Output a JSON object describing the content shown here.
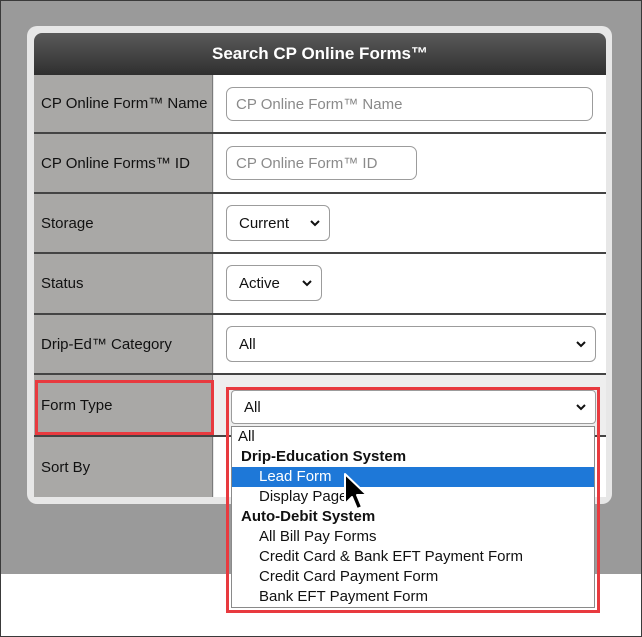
{
  "form": {
    "title": "Search CP Online Forms™",
    "fields": {
      "name": {
        "label": "CP Online Form™ Name",
        "placeholder": "CP Online Form™ Name"
      },
      "id": {
        "label": "CP Online Forms™ ID",
        "placeholder": "CP Online Form™ ID"
      },
      "storage": {
        "label": "Storage",
        "value": "Current"
      },
      "status": {
        "label": "Status",
        "value": "Active"
      },
      "category": {
        "label": "Drip-Ed™ Category",
        "value": "All"
      },
      "form_type": {
        "label": "Form Type",
        "value": "All"
      },
      "sort_by": {
        "label": "Sort By"
      }
    }
  },
  "dropdown": {
    "option_all": "All",
    "group_drip": "Drip-Education System",
    "opt_lead": "Lead Form",
    "opt_display": "Display Page",
    "group_auto": "Auto-Debit System",
    "opt_all_bill": "All Bill Pay Forms",
    "opt_cc_eft": "Credit Card & Bank EFT Payment Form",
    "opt_cc": "Credit Card Payment Form",
    "opt_eft": "Bank EFT Payment Form",
    "highlighted": "Lead Form"
  },
  "icons": {
    "select_arrow": "chevron-down-icon",
    "cursor": "mouse-pointer-icon"
  },
  "colors": {
    "highlight": "#1e78d8",
    "annotation": "#e83a3f",
    "header": "#3a3a3a",
    "label_bg": "#a9a8a6"
  }
}
